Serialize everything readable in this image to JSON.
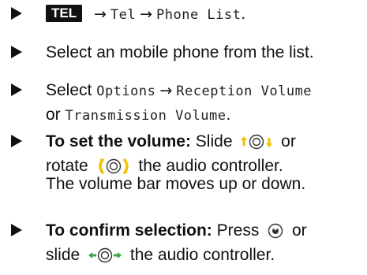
{
  "steps": [
    {
      "key_label": "TEL",
      "menu1": "Tel",
      "menu2": "Phone List",
      "end": "."
    },
    {
      "text": "Select an mobile phone from the list."
    },
    {
      "prefix": "Select ",
      "menu1": "Options",
      "menu2": "Reception Volume",
      "line2_or": "or ",
      "menu3": "Transmission Volume",
      "end": "."
    },
    {
      "bold": "To set the volume:",
      "part1": " Slide ",
      "part2": " or",
      "line2_prefix": "rotate ",
      "line2_suffix": " the audio controller."
    },
    {
      "bold": "To confirm selection:",
      "part1": " Press ",
      "part2": " or",
      "line2_prefix": "slide ",
      "line2_suffix": " the audio controller."
    }
  ],
  "note": "The volume bar moves up or down.",
  "separator": "→",
  "icons": {
    "bullet": "triangle-bullet-icon",
    "slide_up_down": "slide-up-down-controller-icon",
    "rotate": "rotate-controller-icon",
    "press": "press-controller-icon",
    "slide_left_right": "slide-left-right-controller-icon"
  },
  "colors": {
    "text": "#111111",
    "controller_arrow": "#f2c200",
    "controller_arrow_green": "#3aa64a",
    "key_bg": "#111111"
  }
}
